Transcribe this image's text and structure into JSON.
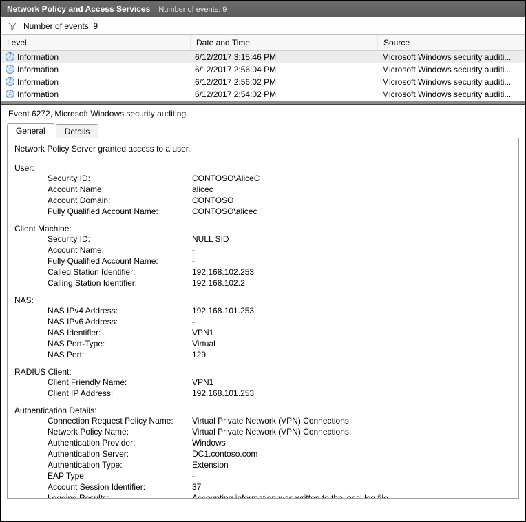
{
  "titlebar": {
    "title": "Network Policy and Access Services",
    "subtitle": "Number of events: 9"
  },
  "filterbar": {
    "text": "Number of events: 9"
  },
  "grid": {
    "headers": {
      "level": "Level",
      "date": "Date and Time",
      "source": "Source"
    },
    "rows": [
      {
        "level": "Information",
        "date": "6/12/2017 3:15:46 PM",
        "source": "Microsoft Windows security auditi..."
      },
      {
        "level": "Information",
        "date": "6/12/2017 2:56:04 PM",
        "source": "Microsoft Windows security auditi..."
      },
      {
        "level": "Information",
        "date": "6/12/2017 2:56:02 PM",
        "source": "Microsoft Windows security auditi..."
      },
      {
        "level": "Information",
        "date": "6/12/2017 2:54:02 PM",
        "source": "Microsoft Windows security auditi..."
      }
    ]
  },
  "event": {
    "header": "Event 6272, Microsoft Windows security auditing.",
    "tabs": {
      "general": "General",
      "details": "Details"
    },
    "message": "Network Policy Server granted access to a user.",
    "sections": {
      "user": {
        "title": "User:",
        "items": [
          {
            "k": "Security ID:",
            "v": "CONTOSO\\AliceC"
          },
          {
            "k": "Account Name:",
            "v": "alicec"
          },
          {
            "k": "Account Domain:",
            "v": "CONTOSO"
          },
          {
            "k": "Fully Qualified Account Name:",
            "v": "CONTOSO\\alicec"
          }
        ]
      },
      "client": {
        "title": "Client Machine:",
        "items": [
          {
            "k": "Security ID:",
            "v": "NULL SID"
          },
          {
            "k": "Account Name:",
            "v": "-"
          },
          {
            "k": "Fully Qualified Account Name:",
            "v": "-"
          },
          {
            "k": "Called Station Identifier:",
            "v": "192.168.102.253"
          },
          {
            "k": "Calling Station Identifier:",
            "v": "192.168.102.2"
          }
        ]
      },
      "nas": {
        "title": "NAS:",
        "items": [
          {
            "k": "NAS IPv4 Address:",
            "v": "192.168.101.253"
          },
          {
            "k": "NAS IPv6 Address:",
            "v": "-"
          },
          {
            "k": "NAS Identifier:",
            "v": "VPN1"
          },
          {
            "k": "NAS Port-Type:",
            "v": "Virtual"
          },
          {
            "k": "NAS Port:",
            "v": "129"
          }
        ]
      },
      "radius": {
        "title": "RADIUS Client:",
        "items": [
          {
            "k": "Client Friendly Name:",
            "v": "VPN1"
          },
          {
            "k": "Client IP Address:",
            "v": "192.168.101.253"
          }
        ]
      },
      "auth": {
        "title": "Authentication Details:",
        "items": [
          {
            "k": "Connection Request Policy Name:",
            "v": "Virtual Private Network (VPN) Connections"
          },
          {
            "k": "Network Policy Name:",
            "v": "Virtual Private Network (VPN) Connections"
          },
          {
            "k": "Authentication Provider:",
            "v": "Windows"
          },
          {
            "k": "Authentication Server:",
            "v": "DC1.contoso.com"
          },
          {
            "k": "Authentication Type:",
            "v": "Extension"
          },
          {
            "k": "EAP Type:",
            "v": "-"
          },
          {
            "k": "Account Session Identifier:",
            "v": "37"
          },
          {
            "k": "Logging Results:",
            "v": "Accounting information was written to the local log file."
          }
        ]
      }
    }
  }
}
